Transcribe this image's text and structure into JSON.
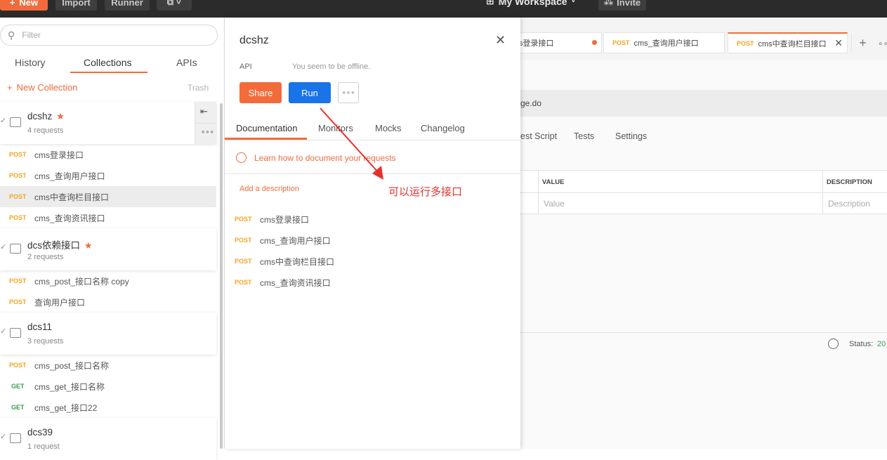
{
  "topbar": {
    "new_label": "New",
    "import_label": "Import",
    "runner_label": "Runner",
    "workspace": "My Workspace",
    "invite_label": "Invite"
  },
  "sidebar": {
    "search_placeholder": "Filter",
    "tabs": [
      "History",
      "Collections",
      "APIs"
    ],
    "new_collection": "New Collection",
    "trash": "Trash",
    "collections": [
      {
        "name": "dcshz",
        "count": "4 requests",
        "starred": true,
        "requests": [
          {
            "method": "POST",
            "name": "cms登录接口"
          },
          {
            "method": "POST",
            "name": "cms_查询用户接口"
          },
          {
            "method": "POST",
            "name": "cms中查询栏目接口"
          },
          {
            "method": "POST",
            "name": "cms_查询资讯接口"
          }
        ]
      },
      {
        "name": "dcs依赖接口",
        "count": "2 requests",
        "starred": true,
        "requests": [
          {
            "method": "POST",
            "name": "cms_post_接口名称 copy"
          },
          {
            "method": "POST",
            "name": "查询用户接口"
          }
        ]
      },
      {
        "name": "dcs11",
        "count": "3 requests",
        "starred": false,
        "requests": [
          {
            "method": "POST",
            "name": "cms_post_接口名称"
          },
          {
            "method": "GET",
            "name": "cms_get_接口名称"
          },
          {
            "method": "GET",
            "name": "cms_get_接口22"
          }
        ]
      },
      {
        "name": "dcs39",
        "count": "1 request",
        "starred": false,
        "requests": []
      }
    ]
  },
  "background": {
    "tabs": [
      {
        "method": "",
        "name": "s登录接口"
      },
      {
        "method": "POST",
        "name": "cms_查询用户接口"
      },
      {
        "method": "POST",
        "name": "cms中查询栏目接口"
      }
    ],
    "url_fragment": "ge.do",
    "subtabs": [
      "est Script",
      "Tests",
      "Settings"
    ],
    "table_headers": [
      "VALUE",
      "DESCRIPTION"
    ],
    "table_placeholders": [
      "Value",
      "Description"
    ],
    "status_label": "Status:",
    "status_value": "20"
  },
  "panel": {
    "title": "dcshz",
    "type_label": "API",
    "offline_msg": "You seem to be offline.",
    "share_label": "Share",
    "run_label": "Run",
    "tabs": [
      "Documentation",
      "Monitors",
      "Mocks",
      "Changelog"
    ],
    "learn_link": "Learn how to document your requests",
    "add_description": "Add a description",
    "requests": [
      {
        "method": "POST",
        "name": "cms登录接口"
      },
      {
        "method": "POST",
        "name": "cms_查询用户接口"
      },
      {
        "method": "POST",
        "name": "cms中查询栏目接口"
      },
      {
        "method": "POST",
        "name": "cms_查询资讯接口"
      }
    ]
  },
  "annotation": {
    "text": "可以运行多接口",
    "color": "#e8312b"
  },
  "colors": {
    "accent": "#f26b3a",
    "run": "#1a73e8",
    "post": "#f5a623",
    "get": "#3a9c4d"
  }
}
